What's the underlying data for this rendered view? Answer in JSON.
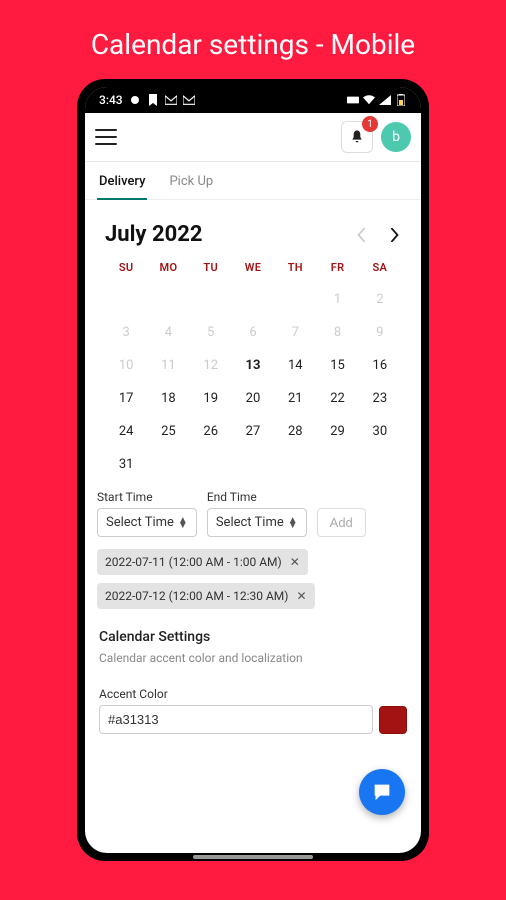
{
  "page_heading": "Calendar settings - Mobile",
  "status": {
    "time": "3:43"
  },
  "appbar": {
    "badge": "1",
    "avatar_letter": "b"
  },
  "tabs": [
    "Delivery",
    "Pick Up"
  ],
  "calendar": {
    "title": "July 2022",
    "dows": [
      "SU",
      "MO",
      "TU",
      "WE",
      "TH",
      "FR",
      "SA"
    ],
    "leading_blanks": 5,
    "days_in_month": 31,
    "muted_until": 12,
    "today": 13
  },
  "time": {
    "start_label": "Start Time",
    "end_label": "End Time",
    "select_placeholder": "Select Time",
    "add_label": "Add"
  },
  "chips": [
    "2022-07-11 (12:00 AM - 1:00 AM)",
    "2022-07-12 (12:00 AM - 12:30 AM)"
  ],
  "settings": {
    "title": "Calendar Settings",
    "subtitle": "Calendar accent color and localization",
    "accent_label": "Accent Color",
    "accent_value": "#a31313"
  }
}
